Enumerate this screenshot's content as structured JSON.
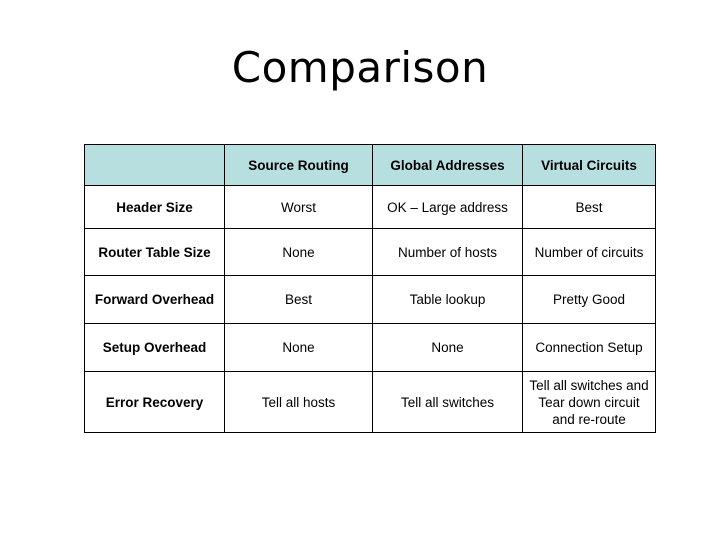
{
  "slide": {
    "title": "Comparison"
  },
  "table": {
    "corner": "",
    "columns": [
      "Source Routing",
      "Global Addresses",
      "Virtual Circuits"
    ],
    "header_color": "#b8dfe0",
    "rows": [
      {
        "label": "Header Size",
        "cells": [
          "Worst",
          "OK – Large address",
          "Best"
        ]
      },
      {
        "label": "Router Table Size",
        "cells": [
          "None",
          "Number of hosts",
          "Number of circuits"
        ]
      },
      {
        "label": "Forward Overhead",
        "cells": [
          "Best",
          "Table lookup",
          "Pretty Good"
        ]
      },
      {
        "label": "Setup Overhead",
        "cells": [
          "None",
          "None",
          "Connection Setup"
        ]
      },
      {
        "label": "Error Recovery",
        "cells": [
          "Tell all hosts",
          "Tell all switches",
          "Tell all switches and Tear down circuit and re-route"
        ]
      }
    ]
  }
}
